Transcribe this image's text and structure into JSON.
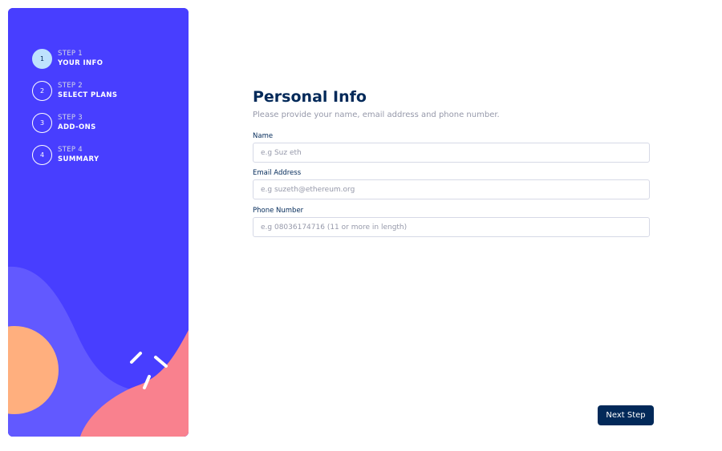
{
  "colors": {
    "sidebar_bg": "#483EFF",
    "active_step": "#BEE2FD",
    "title": "#022959",
    "muted": "#9699AA",
    "border": "#D6D9E6",
    "button_bg": "#022959",
    "shape_orange": "#FFAF7E",
    "shape_pink": "#F9818E",
    "shape_purple": "#6259FF"
  },
  "sidebar": {
    "steps": [
      {
        "num": "1",
        "label": "STEP 1",
        "title": "YOUR INFO",
        "active": true
      },
      {
        "num": "2",
        "label": "STEP 2",
        "title": "SELECT PLANS",
        "active": false
      },
      {
        "num": "3",
        "label": "STEP 3",
        "title": "ADD-ONS",
        "active": false
      },
      {
        "num": "4",
        "label": "STEP 4",
        "title": "SUMMARY",
        "active": false
      }
    ]
  },
  "form": {
    "title": "Personal Info",
    "subtitle": "Please provide your name, email address and phone number.",
    "name": {
      "label": "Name",
      "placeholder": "e.g Suz eth",
      "value": ""
    },
    "email": {
      "label": "Email Address",
      "placeholder": "e.g suzeth@ethereum.org",
      "value": ""
    },
    "phone": {
      "label": "Phone Number",
      "placeholder": "e.g 08036174716 (11 or more in length)",
      "value": ""
    }
  },
  "actions": {
    "next_label": "Next Step"
  }
}
